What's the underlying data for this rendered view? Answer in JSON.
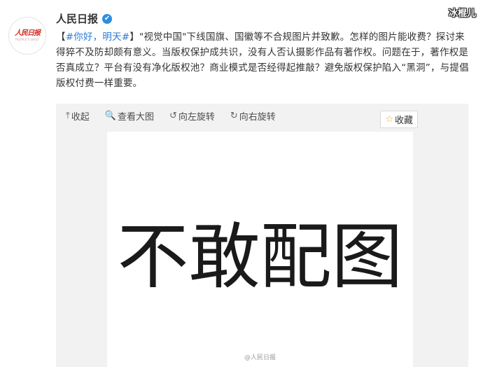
{
  "post": {
    "username": "人民日报",
    "verified_mark": "✔",
    "avatar": {
      "logo_text": "人民日报",
      "logo_sub": "PEOPLE'S DAILY"
    },
    "text": {
      "open": "【",
      "tag": "#你好，明天#",
      "close": "】",
      "body": "\"视觉中国\"下线国旗、国徽等不合规图片并致歉。怎样的图片能收费？探讨来得猝不及防却颇有意义。当版权保护成共识，没有人否认摄影作品有著作权。问题在于，著作权是否真成立？平台有没有净化版权池？商业模式是否经得起推敲？避免版权保护陷入“黑洞”，与提倡版权付费一样重要。"
    }
  },
  "corner_watermark": "冰棍儿",
  "media_toolbar": {
    "collapse": {
      "icon": "⤒",
      "label": "收起"
    },
    "view_large": {
      "icon": "🔍",
      "label": "查看大图"
    },
    "rotate_left": {
      "icon": "↺",
      "label": "向左旋转"
    },
    "rotate_right": {
      "icon": "↻",
      "label": "向右旋转"
    },
    "favorite": {
      "icon": "☆",
      "label": "收藏"
    }
  },
  "image": {
    "main_text": "不敢配图",
    "watermark": "@人民日报"
  }
}
